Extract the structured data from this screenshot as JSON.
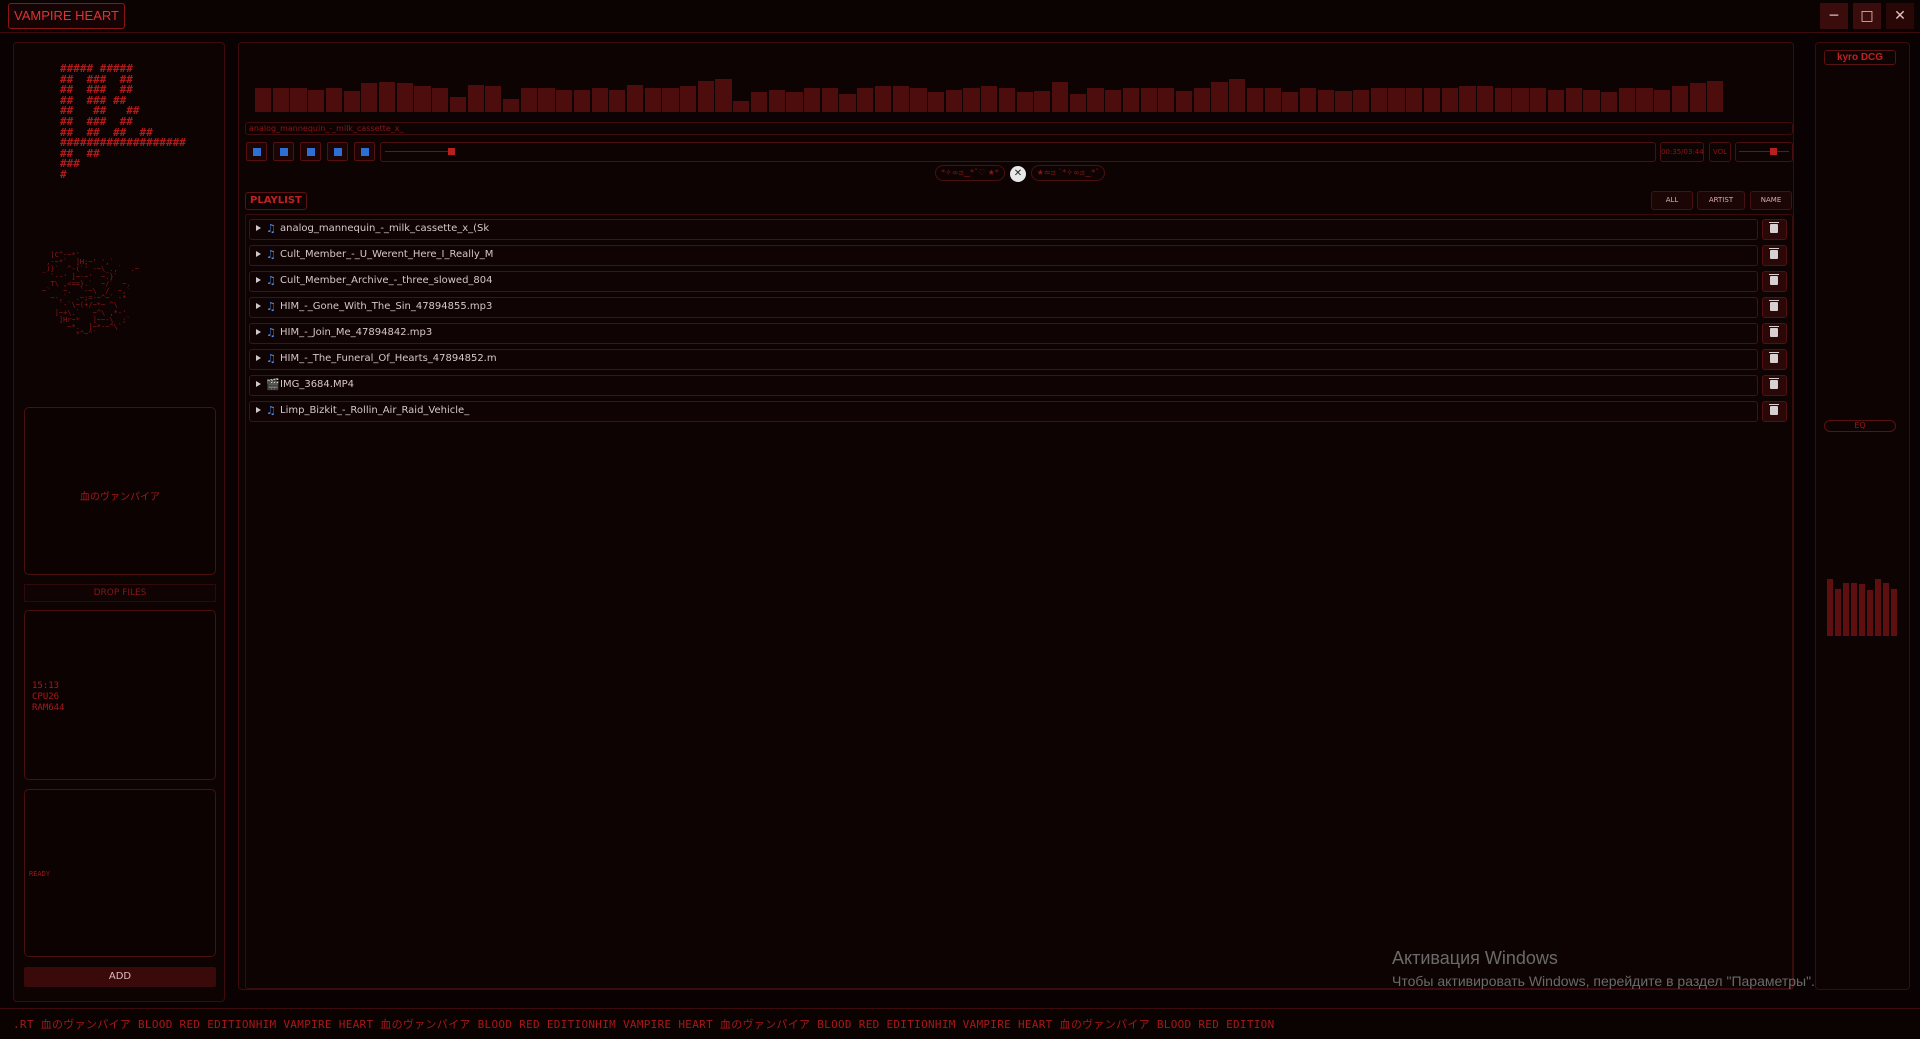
{
  "window": {
    "title": "VAMPIRE HEART",
    "minimize": "─",
    "maximize": "□",
    "close": "✕"
  },
  "sidebar": {
    "ascii_logo": "##### #####\n##  ###  ##\n##  ###  ##\n##  ### ##\n##   ##   ##\n##  ###  ##\n##  ##  ##  ##\n###################\n##  ##\n###\n#",
    "ascii_art": "  ]C^-~*'\n ,-~*`  ]H;~' ',`\n_)}`  ^-(`' -~\\_.,`  .~\n  `--' ]~-~'  ~.}`\n  T\\ ,<==}.`  ~/`  ~.\n~`   ~.  `-~\\  /  ~,`\n  ~-,`  .~;=-~^~` -*\n    `-`\\~(+/~*~ ^\\\n   ]~+\\.`   ~^\\ ,*-'\n    ]Hr~*   ]~~-\\  ;`\n      ~*.  ]~*-~^\\`\n        *^~^`",
    "name_box": "血のヴァンパイア",
    "drop_files": "DROP FILES",
    "stats": {
      "time": "15:13",
      "cpu": "CPU26",
      "ram": "RAM644"
    },
    "status": "READY",
    "add_button": "ADD"
  },
  "player": {
    "now_playing": "analog_mannequin_-_milk_cassette_x_",
    "controls": [
      "prev",
      "play",
      "stop",
      "next",
      "loop"
    ],
    "time": "00:35/03:44",
    "vol_label": "VOL",
    "seek_progress": 0.05,
    "volume": 0.62,
    "kaomoji_left": "*✧∞ಡ‿*ˇ♡ ★*",
    "center_icon": "✕",
    "kaomoji_right": "★≈ಡ `*✧∞ಡ‿*ˇ"
  },
  "visualizer_levels": [
    0.55,
    0.55,
    0.55,
    0.5,
    0.55,
    0.48,
    0.65,
    0.68,
    0.66,
    0.6,
    0.55,
    0.35,
    0.62,
    0.58,
    0.3,
    0.55,
    0.55,
    0.5,
    0.5,
    0.55,
    0.5,
    0.62,
    0.55,
    0.55,
    0.6,
    0.7,
    0.75,
    0.25,
    0.45,
    0.5,
    0.45,
    0.55,
    0.55,
    0.4,
    0.55,
    0.6,
    0.6,
    0.55,
    0.45,
    0.5,
    0.55,
    0.6,
    0.55,
    0.45,
    0.48,
    0.68,
    0.4,
    0.55,
    0.5,
    0.55,
    0.55,
    0.55,
    0.48,
    0.55,
    0.68,
    0.75,
    0.55,
    0.55,
    0.45,
    0.55,
    0.5,
    0.48,
    0.5,
    0.55,
    0.55,
    0.55,
    0.55,
    0.55,
    0.6,
    0.6,
    0.55,
    0.55,
    0.55,
    0.5,
    0.55,
    0.5,
    0.45,
    0.55,
    0.55,
    0.5,
    0.6,
    0.65,
    0.7
  ],
  "playlist": {
    "label": "PLAYLIST",
    "sort": {
      "all": "ALL",
      "artist": "ARTIST",
      "name": "NAME"
    },
    "tracks": [
      {
        "name": "analog_mannequin_-_milk_cassette_x_(Sk",
        "type": "music-icon"
      },
      {
        "name": "Cult_Member_-_U_Werent_Here_I_Really_M",
        "type": "music-icon"
      },
      {
        "name": "Cult_Member_Archive_-_three_slowed_804",
        "type": "music-icon"
      },
      {
        "name": "HIM_-_Gone_With_The_Sin_47894855.mp3",
        "type": "music-icon"
      },
      {
        "name": "HIM_-_Join_Me_47894842.mp3",
        "type": "music-icon"
      },
      {
        "name": "HIM_-_The_Funeral_Of_Hearts_47894852.m",
        "type": "music-icon"
      },
      {
        "name": "IMG_3684.MP4",
        "type": "video-icon"
      },
      {
        "name": "Limp_Bizkit_-_Rollin_Air_Raid_Vehicle_",
        "type": "music-icon"
      }
    ]
  },
  "right_panel": {
    "user": "kyro DCG",
    "eq_button": "EQ",
    "eq_levels": [
      0.75,
      0.62,
      0.7,
      0.7,
      0.68,
      0.6,
      0.75,
      0.7,
      0.62
    ]
  },
  "watermark": {
    "title": "Активация Windows",
    "text": "Чтобы активировать Windows, перейдите в раздел \"Параметры\"."
  },
  "ticker": ".RT 血のヴァンパイア BLOOD RED EDITIONHIM VAMPIRE HEART 血のヴァンパイア BLOOD RED EDITIONHIM VAMPIRE HEART 血のヴァンパイア BLOOD RED EDITIONHIM VAMPIRE HEART 血のヴァンパイア BLOOD RED EDITION",
  "colors": {
    "accent": "#b42020",
    "background": "#0a0202",
    "icon_blue": "#2d6fd4"
  }
}
